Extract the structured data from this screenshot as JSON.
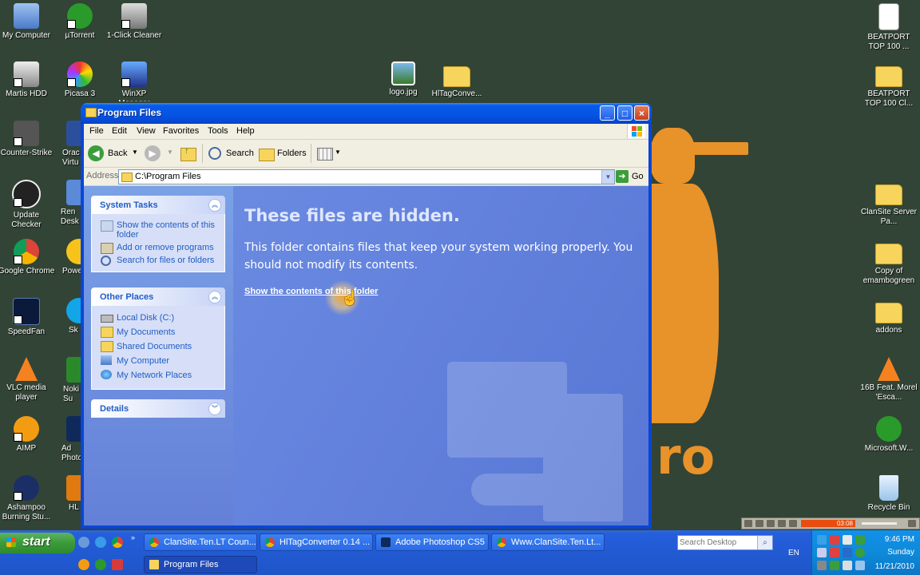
{
  "desktop": {
    "icons_left": [
      {
        "label": "My Computer",
        "icon": "my-computer-icon"
      },
      {
        "label": "µTorrent",
        "icon": "utorrent-icon"
      },
      {
        "label": "1-Click Cleaner",
        "icon": "cleaner-icon"
      },
      {
        "label": "Martis HDD",
        "icon": "hdd-icon"
      },
      {
        "label": "Picasa 3",
        "icon": "picasa-icon"
      },
      {
        "label": "WinXP Manager",
        "icon": "winxp-manager-icon"
      },
      {
        "label": "Counter-Strike",
        "icon": "counter-strike-icon"
      },
      {
        "label": "Orac Virtu",
        "icon": "oracle-virtualbox-icon"
      },
      {
        "label": "Update Checker",
        "icon": "update-checker-icon"
      },
      {
        "label": "Ren Desk",
        "icon": "remote-desktop-icon"
      },
      {
        "label": "Google Chrome",
        "icon": "chrome-icon"
      },
      {
        "label": "Powe",
        "icon": "power-icon"
      },
      {
        "label": "SpeedFan",
        "icon": "speedfan-icon"
      },
      {
        "label": "Sk",
        "icon": "skype-icon"
      },
      {
        "label": "VLC media player",
        "icon": "vlc-icon"
      },
      {
        "label": "Noki Su",
        "icon": "nokia-suite-icon"
      },
      {
        "label": "AIMP",
        "icon": "aimp-icon"
      },
      {
        "label": "Ad Photo",
        "icon": "adobe-photoshop-icon"
      },
      {
        "label": "Ashampoo Burning Stu...",
        "icon": "ashampoo-icon"
      },
      {
        "label": "HL",
        "icon": "hl-icon"
      },
      {
        "label": "logo.jpg",
        "icon": "image-file-icon"
      },
      {
        "label": "HlTagConve...",
        "icon": "zip-folder-icon"
      }
    ],
    "icons_right": [
      {
        "label": "BEATPORT TOP 100 ...",
        "icon": "file-icon"
      },
      {
        "label": "BEATPORT TOP 100 Cl...",
        "icon": "folder-icon"
      },
      {
        "label": "ClanSite Server Pa...",
        "icon": "folder-icon"
      },
      {
        "label": "Copy of emambogreen",
        "icon": "folder-icon"
      },
      {
        "label": "addons",
        "icon": "folder-icon"
      },
      {
        "label": "16B Feat. Morel 'Esca...",
        "icon": "vlc-icon"
      },
      {
        "label": "Microsoft.W...",
        "icon": "utorrent-icon"
      },
      {
        "label": "Recycle Bin",
        "icon": "recycle-bin-icon"
      }
    ],
    "wallpaper_text": "ro"
  },
  "window": {
    "title": "Program Files",
    "menu": [
      "File",
      "Edit",
      "View",
      "Favorites",
      "Tools",
      "Help"
    ],
    "toolbar": {
      "back": "Back",
      "search": "Search",
      "folders": "Folders"
    },
    "address": {
      "label": "Address",
      "value": "C:\\Program Files",
      "go": "Go"
    },
    "system_tasks": {
      "title": "System Tasks",
      "items": [
        "Show the contents of this folder",
        "Add or remove programs",
        "Search for files or folders"
      ]
    },
    "other_places": {
      "title": "Other Places",
      "items": [
        "Local Disk (C:)",
        "My Documents",
        "Shared Documents",
        "My Computer",
        "My Network Places"
      ]
    },
    "details": {
      "title": "Details"
    },
    "main": {
      "heading": "These files are hidden.",
      "message": "This folder contains files that keep your system working properly. You should not modify its contents.",
      "link": "Show the contents of this folder"
    }
  },
  "taskbar": {
    "start": "start",
    "tasks_row1": [
      "ClanSite.Ten.LT Coun...",
      "HlTagConverter 0.14 ...",
      "Adobe Photoshop CS5",
      "Www.ClanSite.Ten.Lt..."
    ],
    "tasks_row2": [
      "Program Files"
    ],
    "search_placeholder": "Search Desktop",
    "lang": "EN",
    "clock": {
      "time": "9:46 PM",
      "day": "Sunday",
      "date": "11/21/2010"
    },
    "player_time": "03:08"
  },
  "colors": {
    "accent": "#0a45d6",
    "wallpaper": "#324436",
    "wallpaper_art": "#e8922a"
  }
}
